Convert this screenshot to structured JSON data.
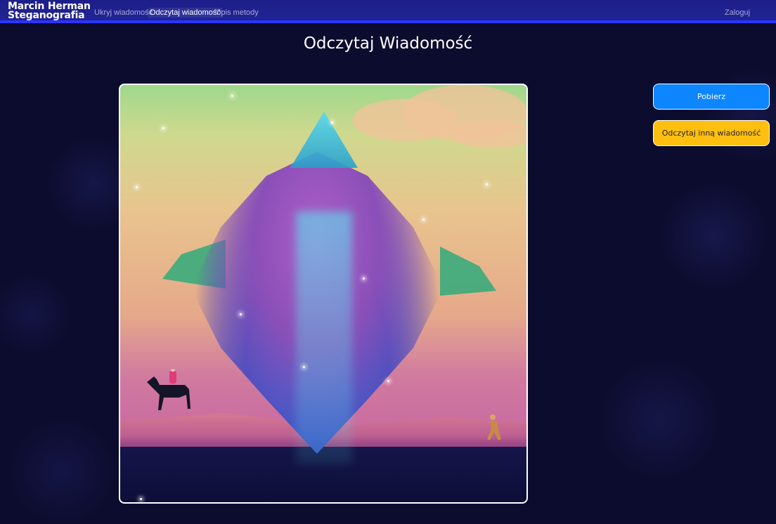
{
  "navbar": {
    "brand_line1": "Marcin Herman",
    "brand_line2": "Steganografia",
    "links": [
      {
        "label": "Ukryj wiadomość",
        "active": false
      },
      {
        "label": "Odczytaj wiadomość",
        "active": true
      },
      {
        "label": "Opis metody",
        "active": false
      }
    ],
    "login_label": "Zaloguj"
  },
  "main": {
    "title": "Odczytaj Wiadomość"
  },
  "actions": {
    "download_label": "Pobierz",
    "read_other_label": "Odczytaj inną wiadomość"
  },
  "colors": {
    "navbar_bg": "#1e1e8a",
    "navbar_accent": "#2c34ff",
    "page_bg": "#0c0c2e",
    "download_button": "#0d86ff",
    "read_other_button": "#ffbf10"
  }
}
